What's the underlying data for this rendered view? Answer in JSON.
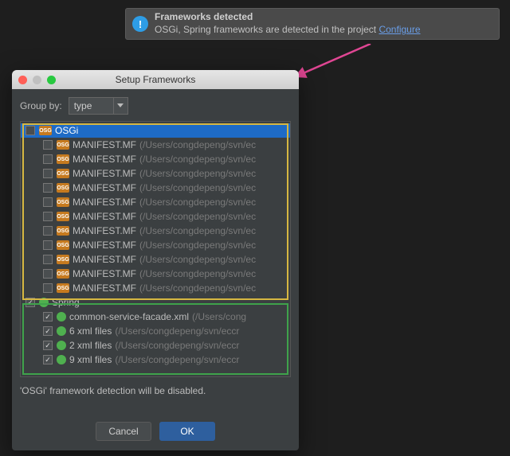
{
  "notification": {
    "title": "Frameworks detected",
    "message": "OSGi, Spring frameworks are detected in the project ",
    "link": "Configure"
  },
  "dialog": {
    "title": "Setup Frameworks",
    "group_by_label": "Group by:",
    "group_by_value": "type",
    "status": "'OSGi' framework detection will be disabled.",
    "cancel": "Cancel",
    "ok": "OK"
  },
  "tree": {
    "osgi": {
      "label": "OSGi",
      "checked": false,
      "items": [
        {
          "name": "MANIFEST.MF",
          "path": "(/Users/congdepeng/svn/ec",
          "checked": false
        },
        {
          "name": "MANIFEST.MF",
          "path": "(/Users/congdepeng/svn/ec",
          "checked": false
        },
        {
          "name": "MANIFEST.MF",
          "path": "(/Users/congdepeng/svn/ec",
          "checked": false
        },
        {
          "name": "MANIFEST.MF",
          "path": "(/Users/congdepeng/svn/ec",
          "checked": false
        },
        {
          "name": "MANIFEST.MF",
          "path": "(/Users/congdepeng/svn/ec",
          "checked": false
        },
        {
          "name": "MANIFEST.MF",
          "path": "(/Users/congdepeng/svn/ec",
          "checked": false
        },
        {
          "name": "MANIFEST.MF",
          "path": "(/Users/congdepeng/svn/ec",
          "checked": false
        },
        {
          "name": "MANIFEST.MF",
          "path": "(/Users/congdepeng/svn/ec",
          "checked": false
        },
        {
          "name": "MANIFEST.MF",
          "path": "(/Users/congdepeng/svn/ec",
          "checked": false
        },
        {
          "name": "MANIFEST.MF",
          "path": "(/Users/congdepeng/svn/ec",
          "checked": false
        },
        {
          "name": "MANIFEST.MF",
          "path": "(/Users/congdepeng/svn/ec",
          "checked": false
        }
      ]
    },
    "spring": {
      "label": "Spring",
      "checked": true,
      "items": [
        {
          "name": "common-service-facade.xml",
          "path": "(/Users/cong",
          "checked": true
        },
        {
          "name": "6 xml files",
          "path": "(/Users/congdepeng/svn/eccr",
          "checked": true
        },
        {
          "name": "2 xml files",
          "path": "(/Users/congdepeng/svn/eccr",
          "checked": true
        },
        {
          "name": "9 xml files",
          "path": "(/Users/congdepeng/svn/eccr",
          "checked": true
        }
      ]
    }
  }
}
